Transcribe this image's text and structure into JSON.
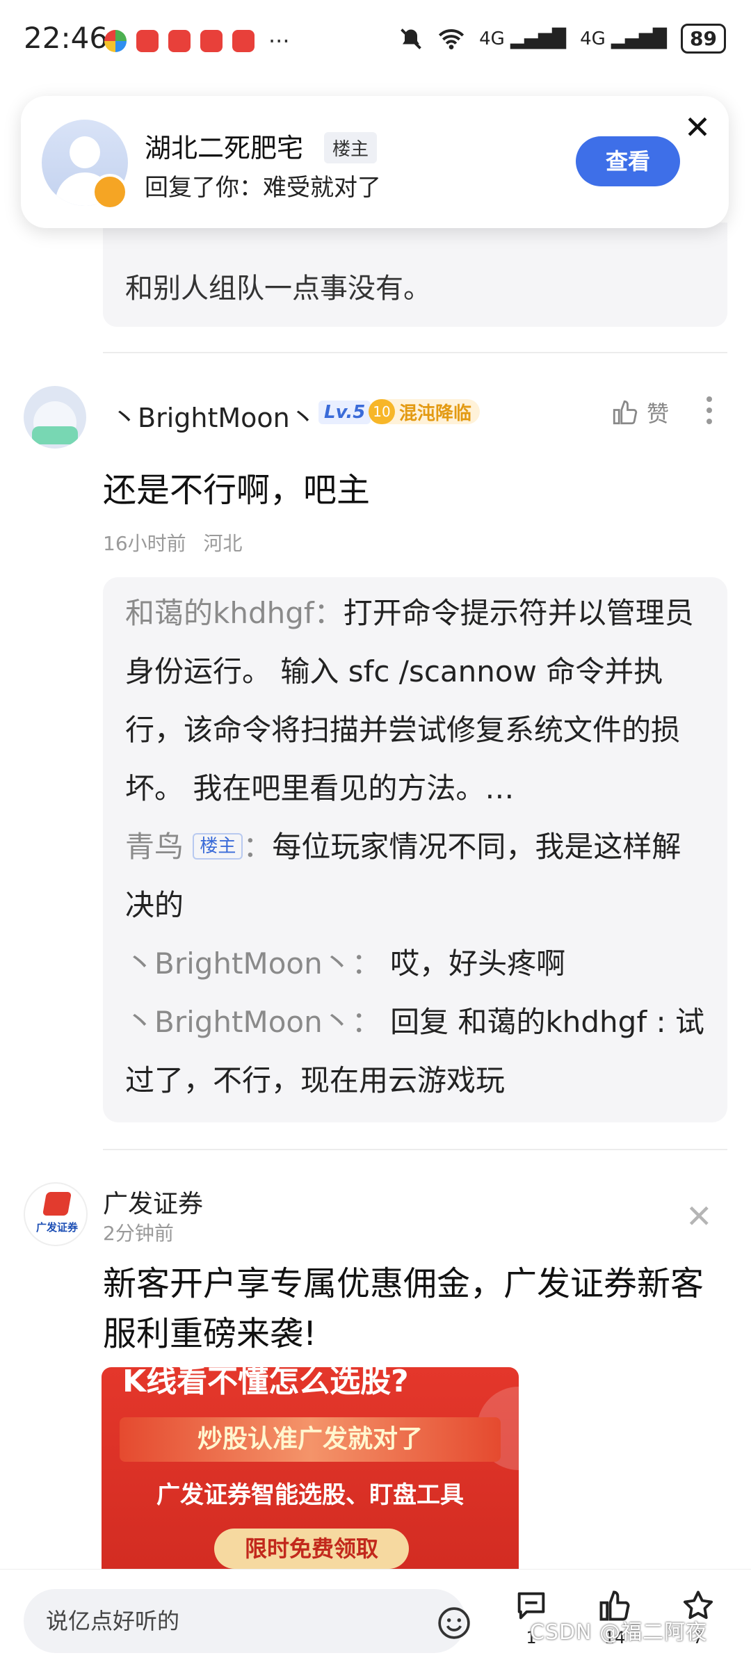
{
  "status_bar": {
    "time": "22:46",
    "network": "4G",
    "network2": "4G",
    "battery": "89"
  },
  "notification": {
    "user": "湖北二死肥宅",
    "tag": "楼主",
    "message": "回复了你：难受就对了",
    "view_label": "查看",
    "close_icon": "close-icon"
  },
  "previous_reply": {
    "text": "和别人组队一点事没有。"
  },
  "comment": {
    "username": "丶BrightMoon丶",
    "level": "Lv.5",
    "fan_level": "10",
    "fan_title": "混沌降临",
    "like_label": "赞",
    "content": "还是不行啊，吧主",
    "time": "16小时前",
    "location": "河北",
    "replies": [
      {
        "name": "和蔼的khdhgf",
        "tag": "",
        "sep": "：",
        "text": "打开命令提示符并以管理员身份运行。 输入 sfc /scannow 命令并执行，该命令将扫描并尝试修复系统文件的损坏。 我在吧里看见的方法。…"
      },
      {
        "name": "青鸟",
        "tag": "楼主",
        "sep": "：",
        "text": "每位玩家情况不同，我是这样解决的"
      },
      {
        "name": "丶BrightMoon丶",
        "tag": "",
        "sep": "： ",
        "text": "哎，好头疼啊"
      },
      {
        "name": "丶BrightMoon丶",
        "tag": "",
        "sep": "： ",
        "text": "回复 和蔼的khdhgf : 试过了，不行，现在用云游戏玩"
      }
    ]
  },
  "ad": {
    "name": "广发证券",
    "logo_text": "广发证券",
    "time": "2分钟前",
    "text": "新客开户享专属优惠佣金，广发证券新客服利重磅来袭!",
    "banner_line1": "K线看不懂怎么选股?",
    "banner_line2": "炒股认准广发就对了",
    "banner_line3": "广发证券智能选股、盯盘工具",
    "banner_button": "限时免费领取"
  },
  "bottom_bar": {
    "input_placeholder": "说亿点好听的",
    "comment_count": "1",
    "like_count": "14",
    "favorite_count": "7",
    "watermark": "CSDN @福二阿夜"
  },
  "colors": {
    "accent_blue": "#3e6fe8",
    "ad_red": "#d32c22",
    "fan_gold": "#f7b628"
  }
}
